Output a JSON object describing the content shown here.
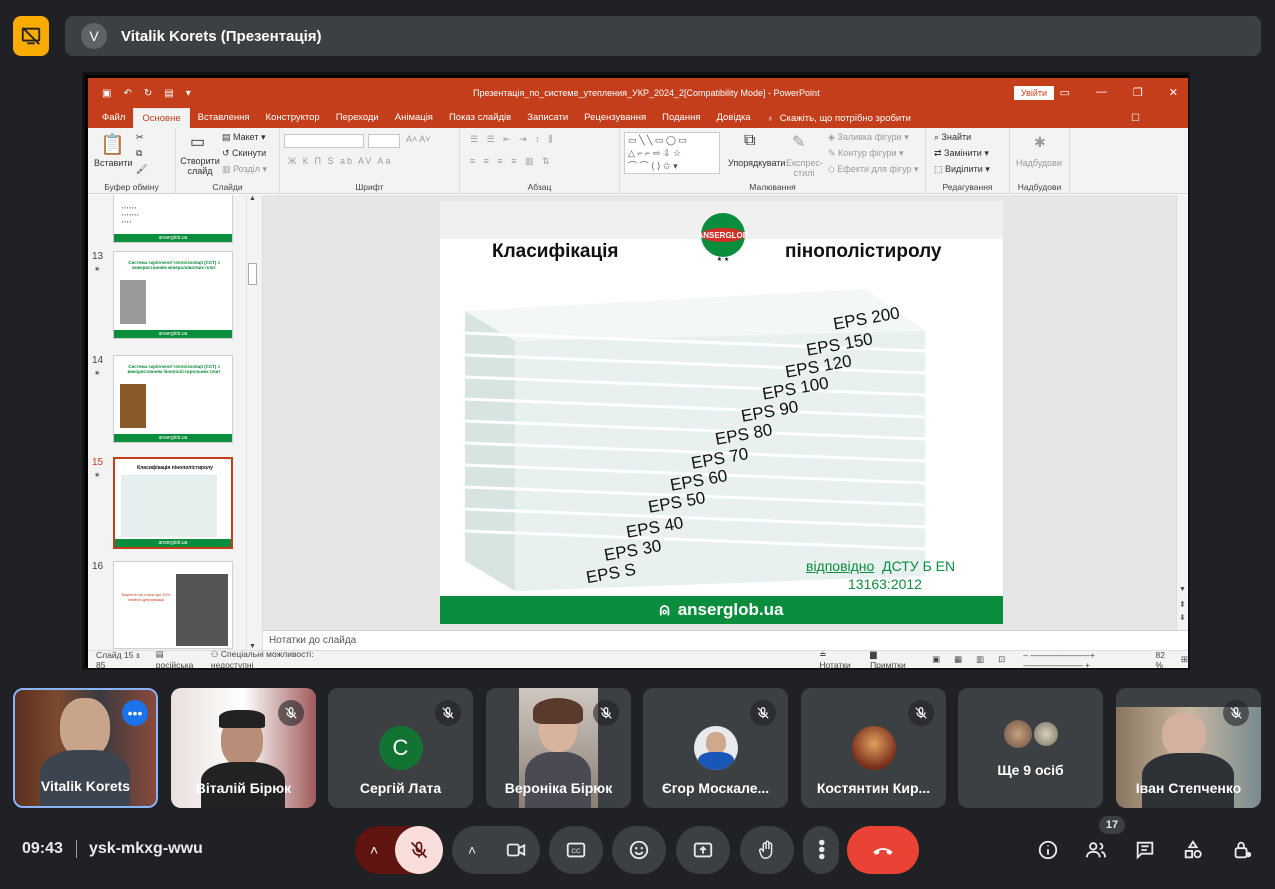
{
  "presenter": {
    "initial": "V",
    "title": "Vitalik Korets (Презентація)"
  },
  "ppt": {
    "window_title": "Презентація_по_системе_утепления_УКР_2024_2[Compatibility Mode]  -  PowerPoint",
    "signin": "Увійти",
    "tabs": [
      "Файл",
      "Основне",
      "Вставлення",
      "Конструктор",
      "Переходи",
      "Анімація",
      "Показ слайдів",
      "Записати",
      "Рецензування",
      "Подання",
      "Довідка"
    ],
    "tell_me": "Скажіть, що потрібно зробити",
    "ribbon": {
      "paste": "Вставити",
      "clipboard": "Буфер обміну",
      "new_slide": "Створити слайд",
      "layout": "Макет",
      "reset": "Скинути",
      "section": "Розділ",
      "slides": "Слайди",
      "font": "Шрифт",
      "font_btns": "Ж  К  П  S  ab  AV  Aa",
      "paragraph": "Абзац",
      "arrange": "Упорядкувати",
      "quick_styles": "Експрес-стилі",
      "shape_fill": "Заливка фігури",
      "shape_outline": "Контур фігури",
      "shape_effects": "Ефекти для фігур",
      "drawing": "Малювання",
      "find": "Знайти",
      "replace": "Замінити",
      "select": "Виділити",
      "editing": "Редагування",
      "add_ins_btn": "Надбудови",
      "add_ins": "Надбудови"
    },
    "thumbs": [
      {
        "num": "13",
        "title": "Система скріпленої теплоізоляції (ССТ) з використанням мінераловатних плит"
      },
      {
        "num": "14",
        "title": "Система скріпленої теплоізоляції (ССТ) з використанням пінополістирольних плит"
      },
      {
        "num": "15",
        "title": "Класифікація пінополістиролу"
      },
      {
        "num": "16",
        "title": "Міцність на стиск при 10% лінійній деформації"
      }
    ],
    "thumb_footer": "anserglob.ua",
    "slide": {
      "title_left": "Класифікація",
      "title_right": "пінополістиролу",
      "logo": "ANSERGLOB",
      "eps": [
        "EPS 200",
        "EPS 150",
        "EPS 120",
        "EPS 100",
        "EPS 90",
        "EPS 80",
        "EPS 70",
        "EPS 60",
        "EPS 50",
        "EPS 40",
        "EPS 30",
        "EPS S"
      ],
      "dstu_word": "відповідно",
      "dstu_rest": "ДСТУ Б EN",
      "dstu_line2": "13163:2012",
      "footer": "anserglob.ua"
    },
    "notes_placeholder": "Нотатки до слайда",
    "status": {
      "slide": "Слайд 15 з 85",
      "lang": "російська",
      "accessibility": "Спеціальні можливості: недоступні",
      "notes": "Нотатки",
      "comments": "Примітки",
      "zoom": "82 %"
    }
  },
  "participants": [
    {
      "name": "Vitalik Korets",
      "type": "video"
    },
    {
      "name": "Віталій Бірюк",
      "type": "video"
    },
    {
      "name": "Сергій Лата",
      "type": "avatar",
      "initial": "С"
    },
    {
      "name": "Вероніка Бірюк",
      "type": "video"
    },
    {
      "name": "Єгор Москале...",
      "type": "photo"
    },
    {
      "name": "Костянтин Кир...",
      "type": "photo"
    },
    {
      "name": "Ще 9 осіб",
      "type": "group"
    },
    {
      "name": "Іван Степченко",
      "type": "video"
    }
  ],
  "bottom": {
    "time": "09:43",
    "meeting_code": "ysk-mkxg-wwu",
    "people_count": "17"
  },
  "colors": {
    "ppt_accent": "#c43e1c",
    "brand_green": "#0a8d3c",
    "hangup": "#ea4335",
    "mic_off": "#f9dedc",
    "presenting": "#f9ab00"
  }
}
